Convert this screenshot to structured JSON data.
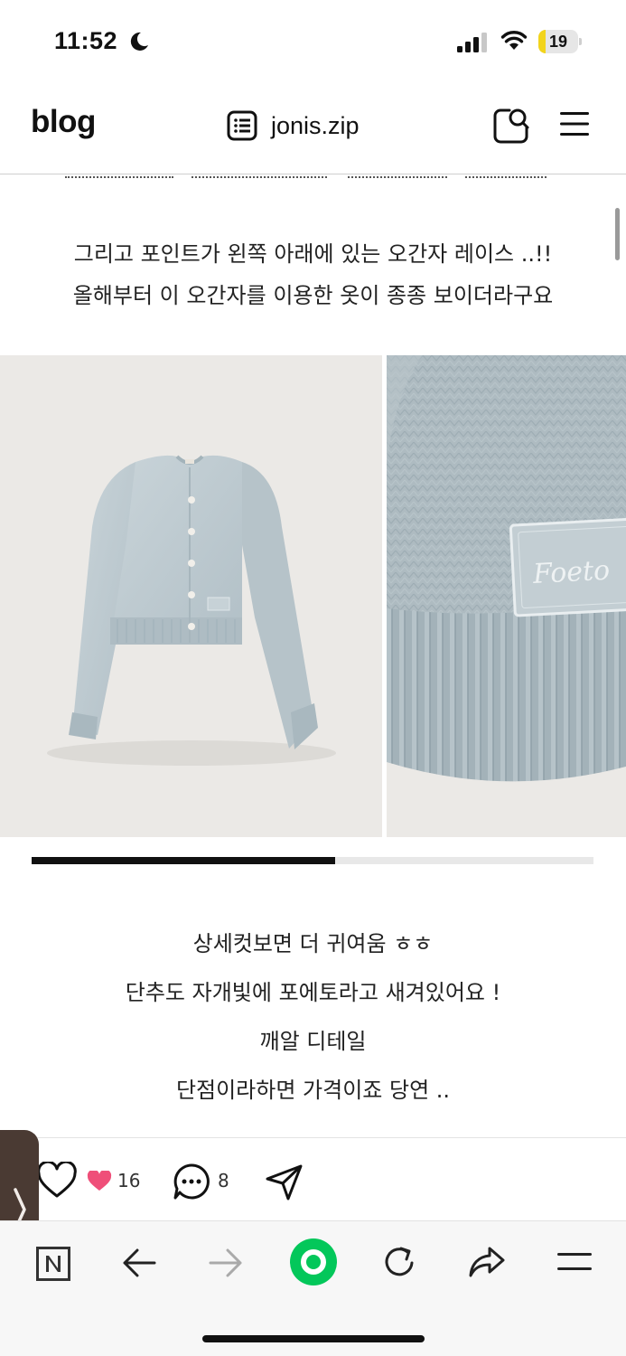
{
  "status_bar": {
    "time": "11:52",
    "battery": "19",
    "battery_level": 0.19,
    "icons": [
      "moon-icon",
      "cellular-signal-icon",
      "wifi-icon",
      "battery-icon"
    ]
  },
  "header": {
    "logo": "blog",
    "blog_name": "jonis.zip",
    "icons": [
      "post-list-icon",
      "blog-search-icon",
      "hamburger-menu-icon"
    ]
  },
  "post": {
    "paragraph_1": [
      "그리고 포인트가 왼쪽 아래에 있는 오간자 레이스 ..!!",
      "올해부터 이 오간자를 이용한 옷이 종종 보이더라구요"
    ],
    "photo_label": "Foeto",
    "carousel_progress": 0.54,
    "paragraph_2": [
      "상세컷보면 더 귀여움 ㅎㅎ",
      "단추도 자개빛에 포에토라고 새겨있어요 !",
      "깨알 디테일",
      "단점이라하면 가격이죠 당연 .."
    ]
  },
  "actions": {
    "like_count": "16",
    "comment_count": "8",
    "icons": [
      "like-heart-icon",
      "sympathy-heart-icon",
      "comment-icon",
      "share-send-icon"
    ]
  },
  "toolbar": {
    "icons": [
      "naver-n-icon",
      "back-arrow-icon",
      "forward-arrow-icon",
      "green-dot-icon",
      "refresh-icon",
      "share-icon",
      "menu-icon"
    ],
    "accent": "#03c75a"
  },
  "colors": {
    "text": "#222222",
    "photo_background": "#ebe9e6",
    "knit": "#b7c4ca",
    "side_tab": "#4a3a33"
  }
}
